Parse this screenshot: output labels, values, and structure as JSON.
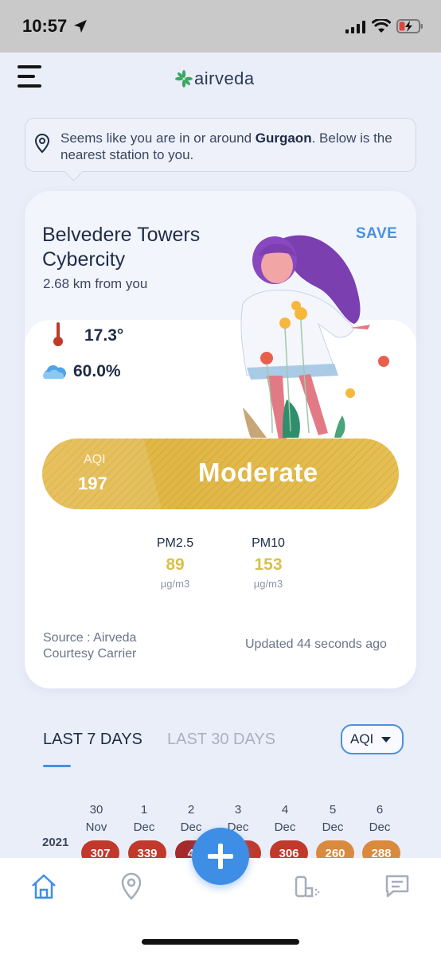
{
  "status_bar": {
    "time": "10:57"
  },
  "header": {
    "logo_text": "airveda"
  },
  "banner": {
    "prefix": "Seems like you are in or around ",
    "city": "Gurgaon",
    "suffix": ". Below is the nearest station to you."
  },
  "station": {
    "name": "Belvedere Towers Cybercity",
    "distance": "2.68 km from you",
    "save_label": "SAVE",
    "temperature": "17.3°",
    "humidity": "60.0%"
  },
  "aqi": {
    "label": "AQI",
    "value": "197",
    "category": "Moderate",
    "color": "#e2b846"
  },
  "pollutants": [
    {
      "name": "PM2.5",
      "value": "89",
      "unit": "µg/m3"
    },
    {
      "name": "PM10",
      "value": "153",
      "unit": "µg/m3"
    }
  ],
  "source": {
    "line1": "Source : Airveda",
    "line2": "Courtesy Carrier"
  },
  "updated": "Updated 44 seconds ago",
  "tabs": {
    "last7": "LAST 7 DAYS",
    "last30": "LAST 30 DAYS"
  },
  "metric_select": {
    "value": "AQI"
  },
  "history": {
    "year": "2021",
    "days": [
      {
        "day": "30",
        "month": "Nov",
        "value": "307",
        "color": "#c0392b"
      },
      {
        "day": "1",
        "month": "Dec",
        "value": "339",
        "color": "#c0392b"
      },
      {
        "day": "2",
        "month": "Dec",
        "value": "40",
        "color": "#a52a2a"
      },
      {
        "day": "3",
        "month": "Dec",
        "value": "",
        "color": "#c0392b"
      },
      {
        "day": "4",
        "month": "Dec",
        "value": "306",
        "color": "#c0392b"
      },
      {
        "day": "5",
        "month": "Dec",
        "value": "260",
        "color": "#d98a3d"
      },
      {
        "day": "6",
        "month": "Dec",
        "value": "288",
        "color": "#d98a3d"
      }
    ]
  },
  "bottom_nav": {
    "items": [
      {
        "icon": "home-icon"
      },
      {
        "icon": "location-pin-icon"
      },
      {
        "icon": "add-icon"
      },
      {
        "icon": "inhaler-icon"
      },
      {
        "icon": "chat-icon"
      }
    ]
  }
}
